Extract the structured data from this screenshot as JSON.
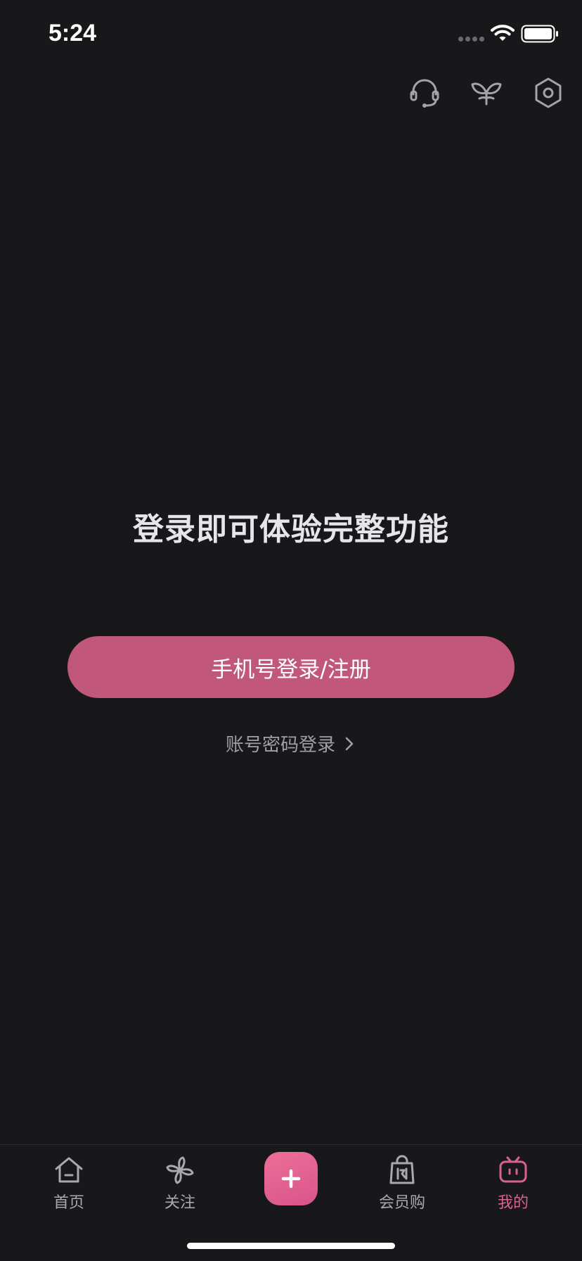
{
  "status_bar": {
    "time": "5:24"
  },
  "top_icons": [
    "headset-icon",
    "sprout-icon",
    "settings-icon"
  ],
  "login": {
    "prompt": "登录即可体验完整功能",
    "phone_button": "手机号登录/注册",
    "password_link": "账号密码登录"
  },
  "tabs": [
    {
      "label": "首页",
      "icon": "home-icon"
    },
    {
      "label": "关注",
      "icon": "pinwheel-icon"
    },
    {
      "label": "",
      "icon": "plus-icon"
    },
    {
      "label": "会员购",
      "icon": "shopping-bag-icon"
    },
    {
      "label": "我的",
      "icon": "tv-icon"
    }
  ],
  "colors": {
    "background": "#18181a",
    "accent": "#c2577c",
    "tab_active": "#d9628d",
    "fab": "#e7658f"
  }
}
